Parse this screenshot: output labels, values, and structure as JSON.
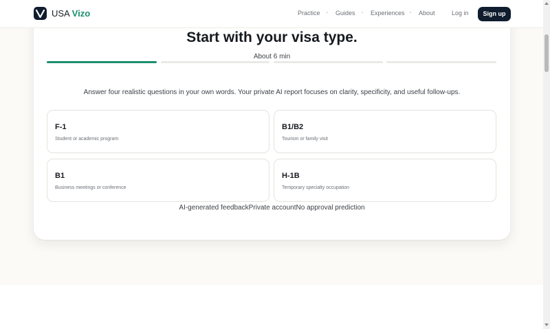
{
  "header": {
    "brand_prefix": "USA",
    "brand_accent": "Vizo",
    "nav": [
      "Practice",
      "Guides",
      "Experiences",
      "About"
    ],
    "login": "Log in",
    "signup": "Sign up"
  },
  "hero": {
    "title": "Start with your visa type.",
    "duration": "About 6 min",
    "progress": {
      "steps": 4,
      "current": 1
    },
    "intro": "Answer four realistic questions in your own words. Your private AI report focuses on clarity, specificity, and useful follow-ups."
  },
  "visa_options": [
    {
      "code": "F-1",
      "description": "Student or academic program"
    },
    {
      "code": "B1/B2",
      "description": "Tourism or family visit"
    },
    {
      "code": "B1",
      "description": "Business meetings or conference"
    },
    {
      "code": "H-1B",
      "description": "Temporary specialty occupation"
    }
  ],
  "features": [
    "AI-generated feedback",
    "Private account",
    "No approval prediction"
  ],
  "colors": {
    "accent": "#1a8f6c",
    "navy": "#0f1d2e",
    "background": "#fcfaf6"
  },
  "icons": {
    "logo": "v-logo-icon"
  }
}
